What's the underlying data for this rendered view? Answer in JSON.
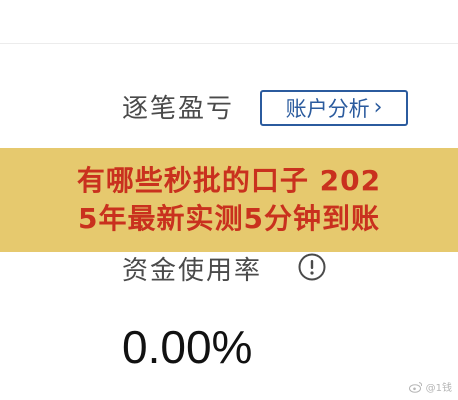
{
  "pnl": {
    "label": "逐笔盈亏",
    "account_button_label": "账户分析",
    "chevron_icon": "chevron-right-icon"
  },
  "banner": {
    "line1": "有哪些秒批的口子 202",
    "line2": "5年最新实测5分钟到账",
    "background_color": "#e6c96e",
    "text_color": "#c9311e"
  },
  "usage": {
    "label": "资金使用率",
    "info_icon": "info-icon",
    "value": "0.00%"
  },
  "watermark": {
    "icon": "weibo-logo-icon",
    "text": "@1钱"
  },
  "colors": {
    "accent": "#2b5b9e",
    "label": "#4a4a4a"
  }
}
